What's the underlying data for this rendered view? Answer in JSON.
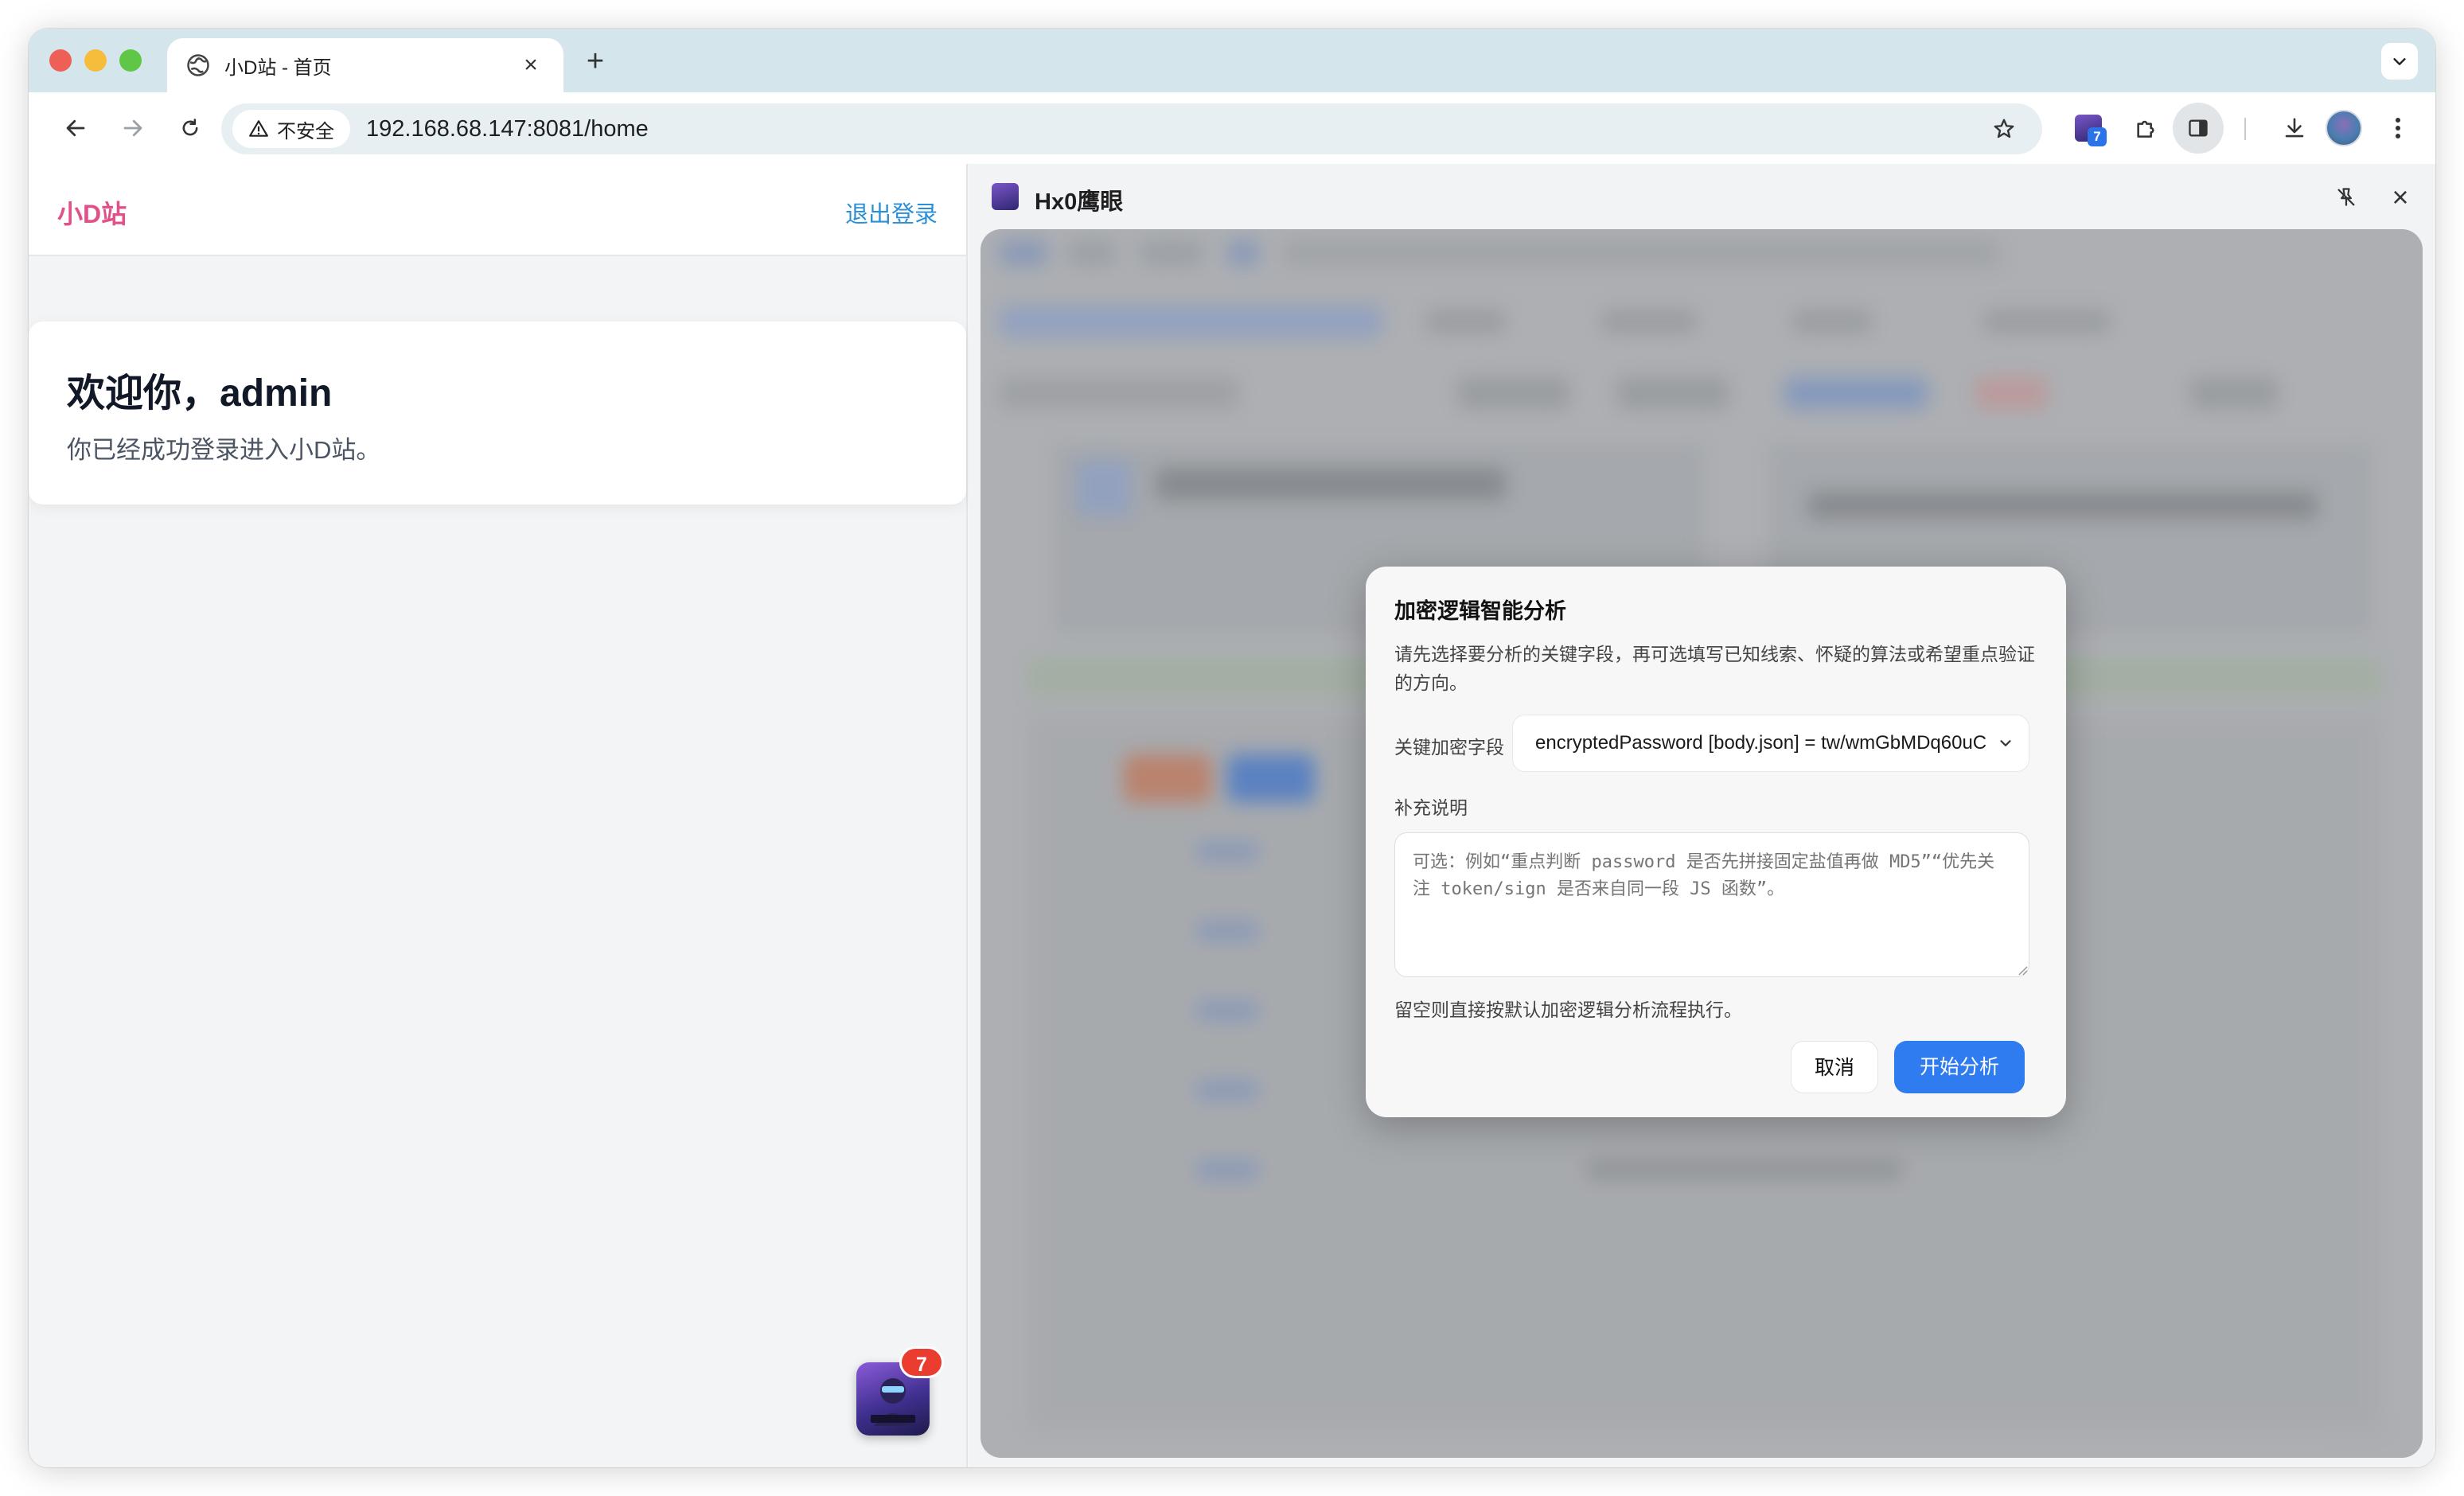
{
  "browser": {
    "tab_title": "小D站 - 首页",
    "tab_close": "×",
    "new_tab": "+",
    "security_label": "不安全",
    "url": "192.168.68.147:8081/home",
    "extension_badge": "7"
  },
  "page": {
    "brand": "小D站",
    "logout": "退出登录",
    "welcome_title": "欢迎你，admin",
    "welcome_subtitle": "你已经成功登录进入小D站。",
    "floating_badge": "7"
  },
  "side_panel": {
    "title": "Hx0鹰眼",
    "close": "×"
  },
  "modal": {
    "title": "加密逻辑智能分析",
    "description": "请先选择要分析的关键字段，再可选填写已知线索、怀疑的算法或希望重点验证的方向。",
    "field_label": "关键加密字段",
    "field_value": "encryptedPassword [body.json] = tw/wmGbMDq60uC",
    "notes_label": "补充说明",
    "notes_placeholder": "可选：例如“重点判断 password 是否先拼接固定盐值再做 MD5”“优先关注 token/sign 是否来自同一段 JS 函数”。",
    "hint": "留空则直接按默认加密逻辑分析流程执行。",
    "cancel": "取消",
    "start": "开始分析"
  },
  "colors": {
    "brand": "#e0518a",
    "link": "#2a8fd6",
    "primary": "#2f7bf0",
    "badge": "#ea3d2f"
  }
}
